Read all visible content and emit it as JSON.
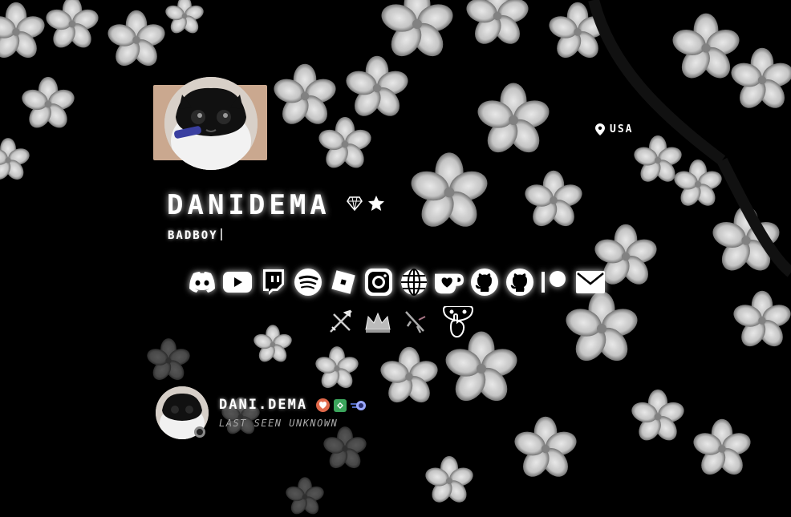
{
  "profile": {
    "username": "DANIDEMA",
    "tagline": "BADBOY",
    "location": "USA",
    "badges": [
      "diamond-icon",
      "star-badge-icon"
    ]
  },
  "socials": [
    {
      "name": "discord-icon"
    },
    {
      "name": "youtube-icon"
    },
    {
      "name": "twitch-icon"
    },
    {
      "name": "spotify-icon"
    },
    {
      "name": "roblox-icon"
    },
    {
      "name": "instagram-icon"
    },
    {
      "name": "globe-icon"
    },
    {
      "name": "kofi-icon"
    },
    {
      "name": "github-icon"
    },
    {
      "name": "github-icon"
    },
    {
      "name": "patreon-icon"
    },
    {
      "name": "mail-icon"
    }
  ],
  "extras": [
    "crossed-swords-icon",
    "crown-icon",
    "rifle-icon",
    "hand-face-icon"
  ],
  "discord": {
    "display_name": "DANI.DEMA",
    "status": "LAST SEEN UNKNOWN",
    "badges": [
      "nitro-heart-icon",
      "hypesquad-icon",
      "boost-icon"
    ]
  },
  "colors": {
    "background": "#000000",
    "text": "#ffffff",
    "muted": "#aaaaaa",
    "badge_orange": "#e0684a",
    "badge_green": "#3ba55c"
  }
}
